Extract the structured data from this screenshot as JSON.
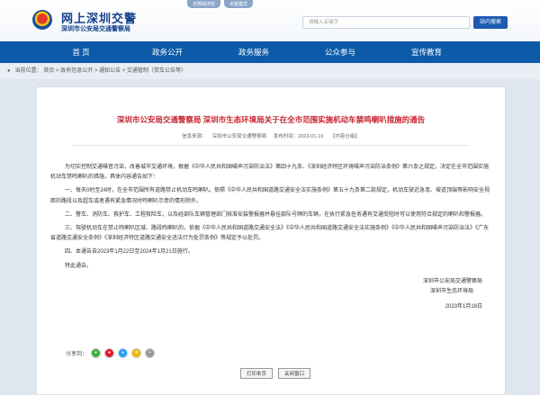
{
  "header": {
    "logo_title": "网上深圳交警",
    "logo_sub": "深圳市公安局交通警察局",
    "top_links": [
      "无障碍浏览",
      "长者模式"
    ],
    "search_placeholder": "请输入关键字",
    "search_button": "站内搜索"
  },
  "nav": {
    "items": [
      "首 页",
      "政务公开",
      "政务服务",
      "公众参与",
      "宣传教育"
    ]
  },
  "breadcrumb": {
    "prefix": "当前位置：",
    "items": [
      "首页",
      "政务信息公开",
      "通知公告",
      "交通管制（货车公告等）"
    ],
    "separator": " > "
  },
  "article": {
    "title": "深圳市公安局交通警察局 深圳市生态环境局关于在全市范围实施机动车禁鸣喇叭措施的通告",
    "meta_source": "信息来源：",
    "meta_source_value": "深圳市公安局交通警察局",
    "meta_time": "发布时间：2023-01-19",
    "meta_size": "【内容分级】",
    "paragraphs": [
      "为切实控制交通噪音污染，改善城市交通环境，根据《中华人民共和国噪声污染防治法》第四十九条、《深圳经济特区环境噪声污染防治条例》第六条之规定，决定在全市范围实施机动车禁鸣喇叭的措施，具体内容通告如下：",
      "一、每天0时至24时，在全市范围所有道路禁止机动车鸣喇叭。依照《中华人民共和国道路交通安全法实施条例》第五十九条第二款规定，机动车驶近急弯、坡道顶端等影响安全视距的路段以及超车或者遇有紧急情况时鸣喇叭示意的情形除外。",
      "二、警车、消防车、救护车、工程救险车，以及经部队车辆管理部门核准安装警报器并悬挂部队号牌的车辆，在执行紧急任务遇有交通受阻时可以使用符合规定的喇叭和警报器。",
      "三、驾驶机动车在禁止鸣喇叭区域、路段鸣喇叭的，依据《中华人民共和国道路交通安全法》《中华人民共和国道路交通安全法实施条例》《中华人民共和国噪声污染防治法》《广东省道路交通安全条例》《深圳经济特区道路交通安全违法行为处罚条例》等规定予以处罚。",
      "四、本通告自2023年1月22日至2024年1月21日施行。",
      "特此通告。"
    ],
    "sign_org1": "深圳市公安局交通警察局",
    "sign_org2": "深圳市生态环境局",
    "sign_date": "2023年1月18日"
  },
  "share": {
    "label": "分享到：",
    "icons": [
      "wechat-icon",
      "weibo-icon",
      "qq-icon",
      "qzone-icon",
      "more-icon"
    ],
    "icon_colors": [
      "#3cb034",
      "#e6162d",
      "#1e9fff",
      "#f5b400",
      "#999999"
    ]
  },
  "actions": {
    "print": "打印本页",
    "close": "关闭窗口"
  }
}
